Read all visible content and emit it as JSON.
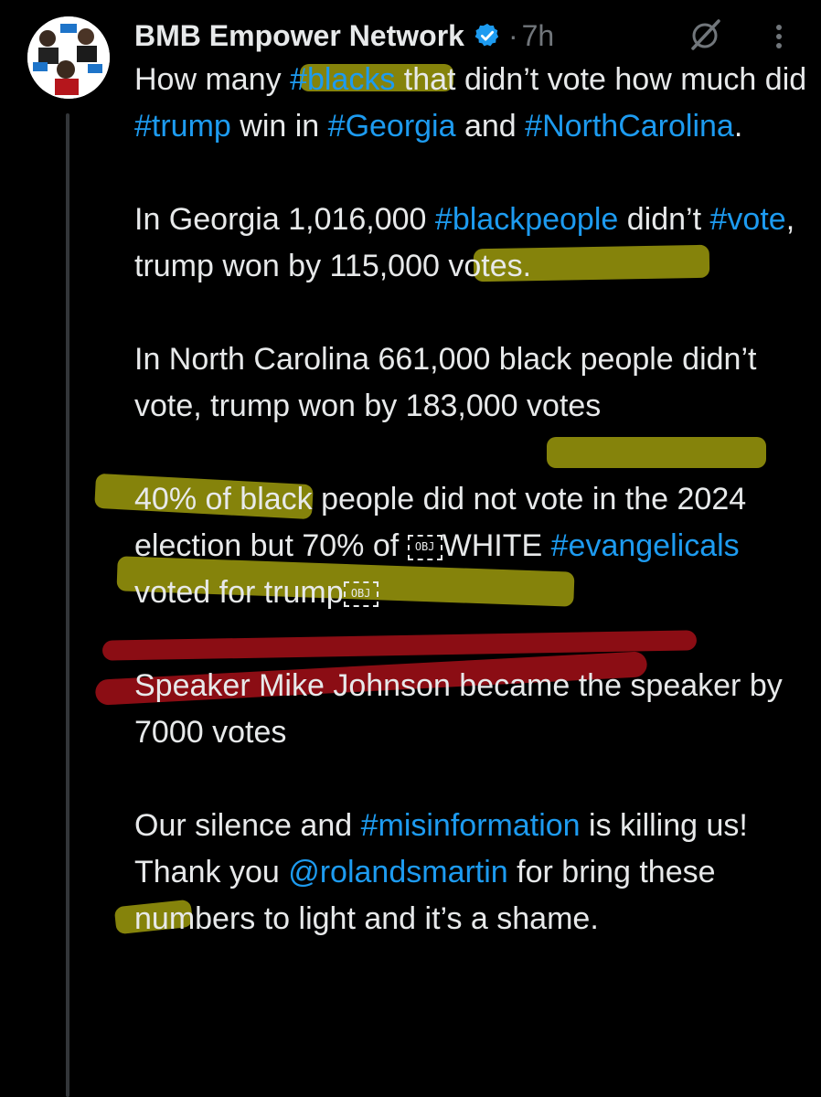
{
  "tweet": {
    "display_name": "BMB Empower Network",
    "dot": "·",
    "time": "7h",
    "paragraphs": [
      {
        "segments": [
          {
            "text": "How many ",
            "tag": false
          },
          {
            "text": "#blacks",
            "tag": true
          },
          {
            "text": " that didn’t vote how much did ",
            "tag": false
          },
          {
            "text": "#trump",
            "tag": true
          },
          {
            "text": " win in ",
            "tag": false
          },
          {
            "text": "#Georgia",
            "tag": true
          },
          {
            "text": " and ",
            "tag": false
          },
          {
            "text": "#NorthCarolina",
            "tag": true
          },
          {
            "text": ".",
            "tag": false
          }
        ]
      },
      {
        "segments": [
          {
            "text": "In Georgia 1,016,000 ",
            "tag": false
          },
          {
            "text": "#blackpeople",
            "tag": true
          },
          {
            "text": " didn’t ",
            "tag": false
          },
          {
            "text": "#vote",
            "tag": true
          },
          {
            "text": ", trump won by 115,000 votes.",
            "tag": false
          }
        ]
      },
      {
        "segments": [
          {
            "text": "In North Carolina 661,000 black people didn’t vote, trump won by 183,000 votes",
            "tag": false
          }
        ]
      },
      {
        "segments": [
          {
            "text": "40% of black people did not vote in the 2024 election but 70% of ",
            "tag": false
          },
          {
            "text": "OBJ",
            "obj": true
          },
          {
            "text": "WHITE ",
            "tag": false
          },
          {
            "text": "#evangelicals",
            "tag": true
          },
          {
            "text": " voted for trump",
            "tag": false
          },
          {
            "text": "OBJ",
            "obj": true
          }
        ]
      },
      {
        "segments": [
          {
            "text": "Speaker Mike Johnson became the speaker by 7000 votes",
            "tag": false
          }
        ]
      },
      {
        "segments": [
          {
            "text": "Our silence and ",
            "tag": false
          },
          {
            "text": "#misinformation",
            "tag": true
          },
          {
            "text": " is killing us! Thank you ",
            "tag": false
          },
          {
            "text": "@rolandsmartin",
            "tag": true
          },
          {
            "text": " for bring these numbers to light and it’s a shame.",
            "tag": false
          }
        ]
      }
    ]
  },
  "colors": {
    "background": "#000000",
    "text": "#e7e9ea",
    "link": "#1d9bf0",
    "muted": "#71767b",
    "highlight_yellow": "#d6d312",
    "highlight_red": "#c0121c"
  },
  "icons": {
    "verified": "verified-badge-icon",
    "grok": "grok-icon",
    "more": "more-options-icon"
  }
}
